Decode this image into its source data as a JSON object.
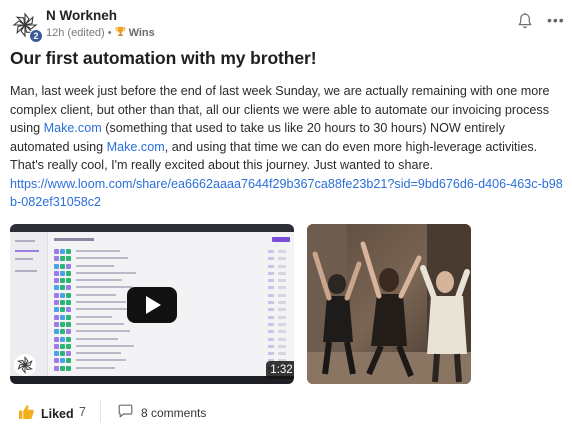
{
  "post": {
    "author": "N Workneh",
    "avatar_level": "2",
    "time": "12h (edited)",
    "separator": "•",
    "category": "Wins",
    "title": "Our first automation with my brother!",
    "body": {
      "part1": "Man, last week just before the end of last week Sunday, we are actually remaining with one more complex client, but other than that, all our clients we were able to automate our invoicing process using ",
      "link1": "Make.com",
      "part2": " (something that used to take us like 20 hours to 30 hours) NOW entirely automated using ",
      "link2": "Make.com",
      "part3": ", and using that time we can do even more high-leverage activities. That's really cool, I'm really excited about this journey. Just wanted to share.",
      "url": "https://www.loom.com/share/ea6662aaaa7644f29b367ca88fe23b21?sid=9bd676d6-d406-463c-b98b-082ef31058c2"
    },
    "media": {
      "video_duration": "1:32"
    },
    "footer": {
      "like_label": "Liked",
      "like_count": "7",
      "comments_label": "8 comments"
    }
  },
  "icons": {
    "avatar": "pinwheel-logo-icon",
    "category": "trophy-icon",
    "notify": "bell-icon",
    "menu": "more-horizontal-icon",
    "like": "thumbs-up-icon",
    "comments": "comment-bubble-icon",
    "play": "play-icon"
  },
  "colors": {
    "link": "#2a6fdb",
    "level_badge": "#3d5a98",
    "trophy": "#f0a020",
    "like_icon": "#f2b01e"
  }
}
